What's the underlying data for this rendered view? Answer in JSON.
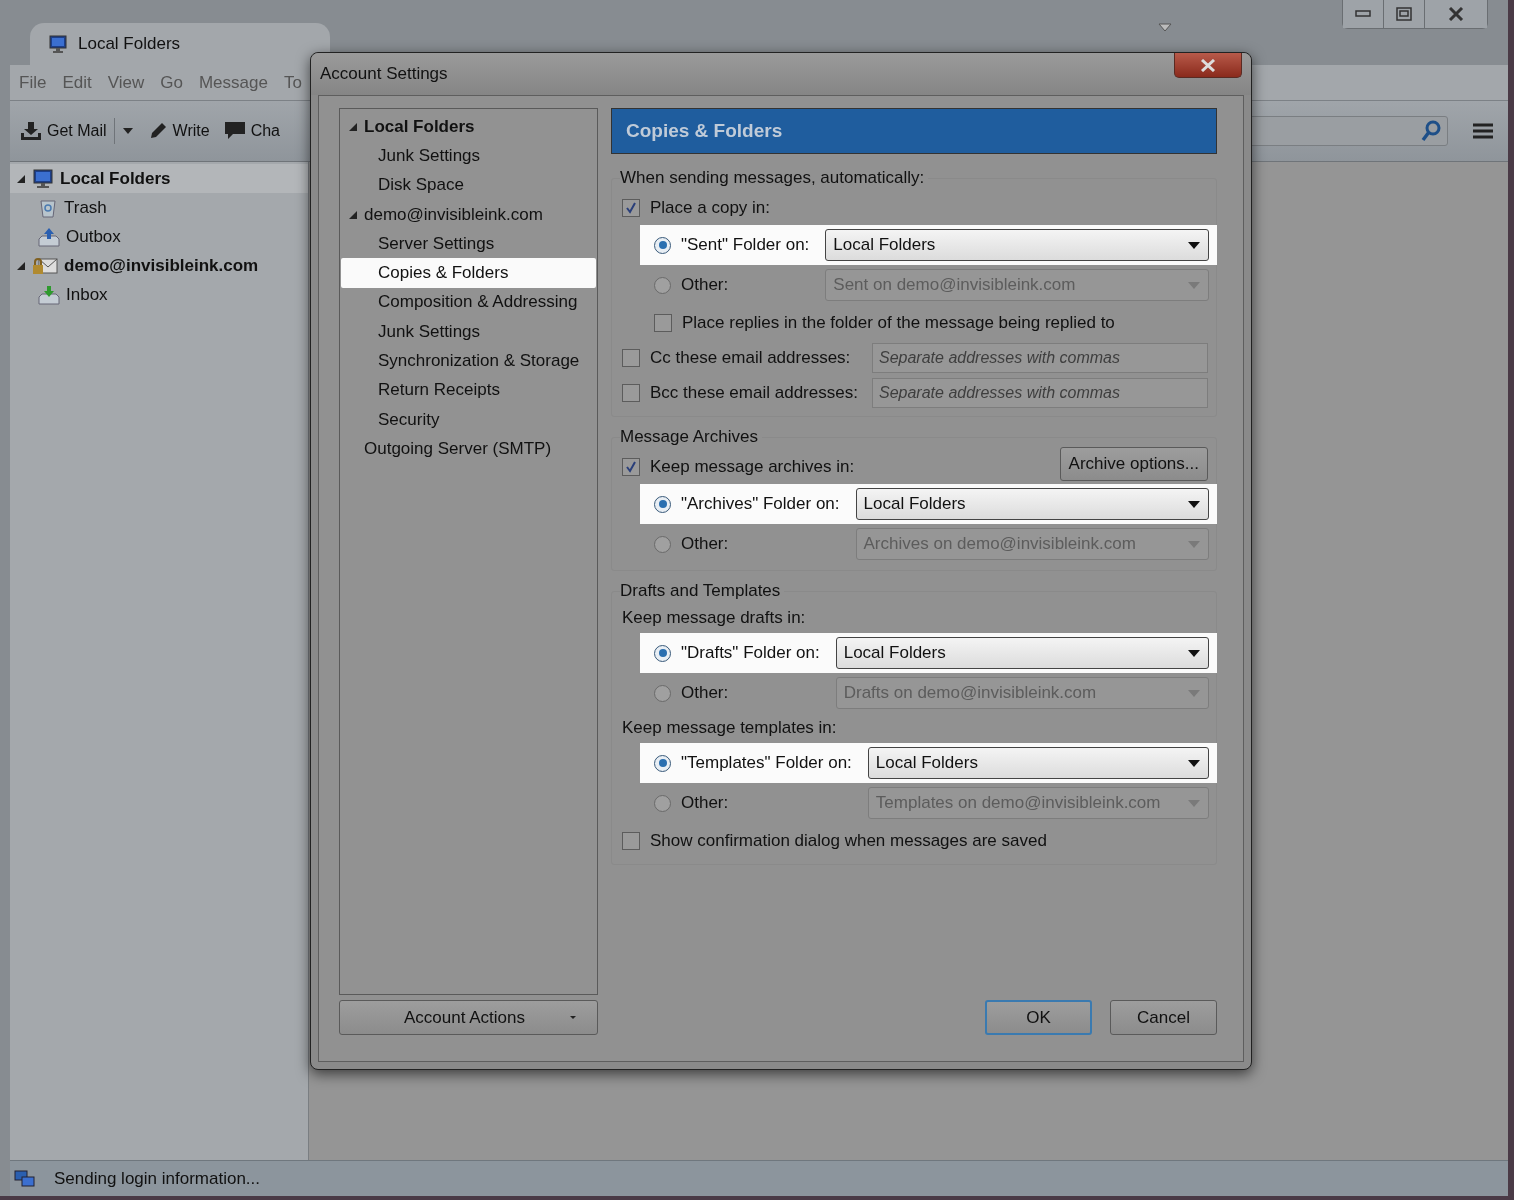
{
  "main_window": {
    "tab": {
      "title": "Local Folders"
    },
    "menu": [
      "File",
      "Edit",
      "View",
      "Go",
      "Message",
      "To"
    ],
    "toolbar": [
      {
        "kind": "get-mail",
        "label": "Get Mail",
        "dropdown": true
      },
      {
        "kind": "write",
        "label": "Write",
        "dropdown": false
      },
      {
        "kind": "chat",
        "label": "Cha",
        "dropdown": false
      }
    ],
    "folders": [
      {
        "kind": "local",
        "label": "Local Folders",
        "expanded": true,
        "selected": true,
        "children": [
          {
            "kind": "trash",
            "label": "Trash",
            "selected": false
          },
          {
            "kind": "outbox",
            "label": "Outbox",
            "selected": false
          }
        ]
      },
      {
        "kind": "account",
        "label": "demo@invisibleink.com",
        "expanded": true,
        "selected": false,
        "children": [
          {
            "kind": "inbox",
            "label": "Inbox",
            "selected": false
          }
        ]
      }
    ],
    "status_bar": {
      "text": "Sending login information..."
    }
  },
  "dialog": {
    "title": "Account Settings",
    "accounts": [
      {
        "label": "Local Folders",
        "default": true,
        "expanded": true,
        "selected": false,
        "children": [
          {
            "label": "Junk Settings",
            "selected": false
          },
          {
            "label": "Disk Space",
            "selected": false
          }
        ]
      },
      {
        "label": "demo@invisibleink.com",
        "default": false,
        "expanded": true,
        "selected": false,
        "children": [
          {
            "label": "Server Settings",
            "selected": false
          },
          {
            "label": "Copies & Folders",
            "selected": true
          },
          {
            "label": "Composition & Addressing",
            "selected": false
          },
          {
            "label": "Junk Settings",
            "selected": false
          },
          {
            "label": "Synchronization & Storage",
            "selected": false
          },
          {
            "label": "Return Receipts",
            "selected": false
          },
          {
            "label": "Security",
            "selected": false
          }
        ]
      },
      {
        "label": "Outgoing Server (SMTP)",
        "default": false,
        "selected": false
      }
    ],
    "account_actions": "Account Actions",
    "panel_title": "Copies & Folders",
    "sections": [
      {
        "legend": "When sending messages, automatically:",
        "items": [
          {
            "kind": "checkbox",
            "label": "Place a copy in:",
            "checked": true
          },
          {
            "kind": "radio-group",
            "options": [
              {
                "label": "\"Sent\" Folder on:",
                "selected": true,
                "value": "Local Folders",
                "highlighted": true
              },
              {
                "label": "Other:",
                "selected": false,
                "value": "Sent on demo@invisibleink.com",
                "highlighted": false
              }
            ]
          },
          {
            "kind": "subcheckbox",
            "label": "Place replies in the folder of the message being replied to",
            "checked": false
          },
          {
            "kind": "checkbox-field",
            "label": "Cc these email addresses:",
            "checked": false,
            "placeholder": "Separate addresses with commas"
          },
          {
            "kind": "checkbox-field",
            "label": "Bcc these email addresses:",
            "checked": false,
            "placeholder": "Separate addresses with commas"
          }
        ]
      },
      {
        "legend": "Message Archives",
        "items": [
          {
            "kind": "checkbox-button",
            "label": "Keep message archives in:",
            "checked": true,
            "button": "Archive options..."
          },
          {
            "kind": "radio-group",
            "options": [
              {
                "label": "\"Archives\" Folder on:",
                "selected": true,
                "value": "Local Folders",
                "highlighted": true
              },
              {
                "label": "Other:",
                "selected": false,
                "value": "Archives on demo@invisibleink.com",
                "highlighted": false
              }
            ]
          }
        ]
      },
      {
        "legend": "Drafts and Templates",
        "items": [
          {
            "kind": "subheading",
            "label": "Keep message drafts in:"
          },
          {
            "kind": "radio-group",
            "options": [
              {
                "label": "\"Drafts\" Folder on:",
                "selected": true,
                "value": "Local Folders",
                "highlighted": true
              },
              {
                "label": "Other:",
                "selected": false,
                "value": "Drafts on demo@invisibleink.com",
                "highlighted": false
              }
            ]
          },
          {
            "kind": "subheading",
            "label": "Keep message templates in:"
          },
          {
            "kind": "radio-group",
            "options": [
              {
                "label": "\"Templates\" Folder on:",
                "selected": true,
                "value": "Local Folders",
                "highlighted": true
              },
              {
                "label": "Other:",
                "selected": false,
                "value": "Templates on demo@invisibleink.com",
                "highlighted": false
              }
            ]
          },
          {
            "kind": "checkbox",
            "label": "Show confirmation dialog when messages are saved",
            "checked": false
          }
        ]
      }
    ],
    "buttons": [
      {
        "label": "OK",
        "default": true
      },
      {
        "label": "Cancel",
        "default": false
      }
    ]
  }
}
